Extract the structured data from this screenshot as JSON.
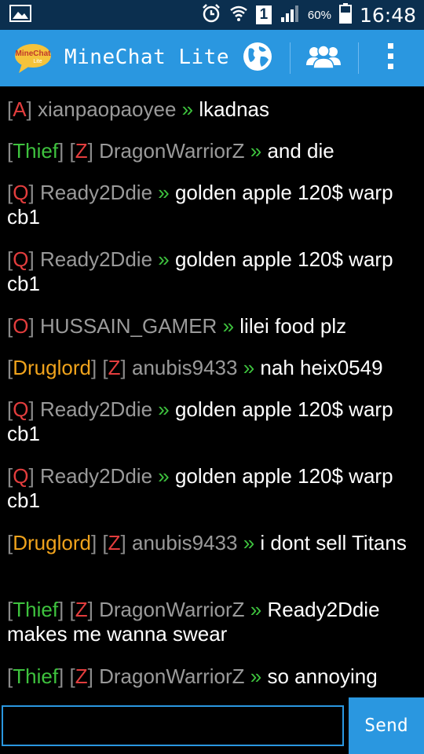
{
  "status_bar": {
    "battery_percent": "60%",
    "time": "16:48",
    "sim_number": "1",
    "icons": [
      "image-icon",
      "alarm-icon",
      "wifi-icon",
      "sim-icon",
      "signal-icon",
      "battery-icon"
    ]
  },
  "action_bar": {
    "logo_text_line1": "MineChat",
    "logo_text_line2": "Lite",
    "title": "MineChat Lite",
    "icons": [
      "globe-icon",
      "people-icon",
      "overflow-menu-icon"
    ]
  },
  "messages": [
    {
      "tags": [
        {
          "text": "A",
          "color": "red"
        }
      ],
      "name": "xianpaopaoyee",
      "text": "lkadnas"
    },
    {
      "tags": [
        {
          "text": "Thief",
          "color": "green"
        },
        {
          "text": "Z",
          "color": "red"
        }
      ],
      "name": "DragonWarriorZ",
      "text": "and die"
    },
    {
      "tags": [
        {
          "text": "Q",
          "color": "red"
        }
      ],
      "name": "Ready2Ddie",
      "text": "golden apple 120$ warp cb1"
    },
    {
      "tags": [
        {
          "text": "Q",
          "color": "red"
        }
      ],
      "name": "Ready2Ddie",
      "text": "golden apple 120$ warp cb1"
    },
    {
      "tags": [
        {
          "text": "O",
          "color": "red"
        }
      ],
      "name": "HUSSAIN_GAMER",
      "text": "lilei food plz"
    },
    {
      "tags": [
        {
          "text": "Druglord",
          "color": "orange"
        },
        {
          "text": "Z",
          "color": "red"
        }
      ],
      "name": "anubis9433",
      "text": "nah heix0549"
    },
    {
      "tags": [
        {
          "text": "Q",
          "color": "red"
        }
      ],
      "name": "Ready2Ddie",
      "text": "golden apple 120$ warp cb1"
    },
    {
      "tags": [
        {
          "text": "Q",
          "color": "red"
        }
      ],
      "name": "Ready2Ddie",
      "text": "golden apple 120$ warp cb1"
    },
    {
      "tags": [
        {
          "text": "Druglord",
          "color": "orange"
        },
        {
          "text": "Z",
          "color": "red"
        }
      ],
      "name": "anubis9433",
      "text": "i dont sell Titans"
    },
    {
      "tags": [
        {
          "text": "Thief",
          "color": "green"
        },
        {
          "text": "Z",
          "color": "red"
        }
      ],
      "name": "DragonWarriorZ",
      "text": "Ready2Ddie makes me wanna swear"
    },
    {
      "tags": [
        {
          "text": "Thief",
          "color": "green"
        },
        {
          "text": "Z",
          "color": "red"
        }
      ],
      "name": "DragonWarriorZ",
      "text": "so annoying"
    }
  ],
  "separator": "»",
  "input": {
    "value": "",
    "placeholder": ""
  },
  "send_label": "Send",
  "colors": {
    "status_bar_bg": "#0b2f4f",
    "accent": "#2a97e0",
    "tag_red": "#e33d3d",
    "tag_green": "#3ec23e",
    "tag_orange": "#f0a31c",
    "name_gray": "#9a9a9a"
  }
}
